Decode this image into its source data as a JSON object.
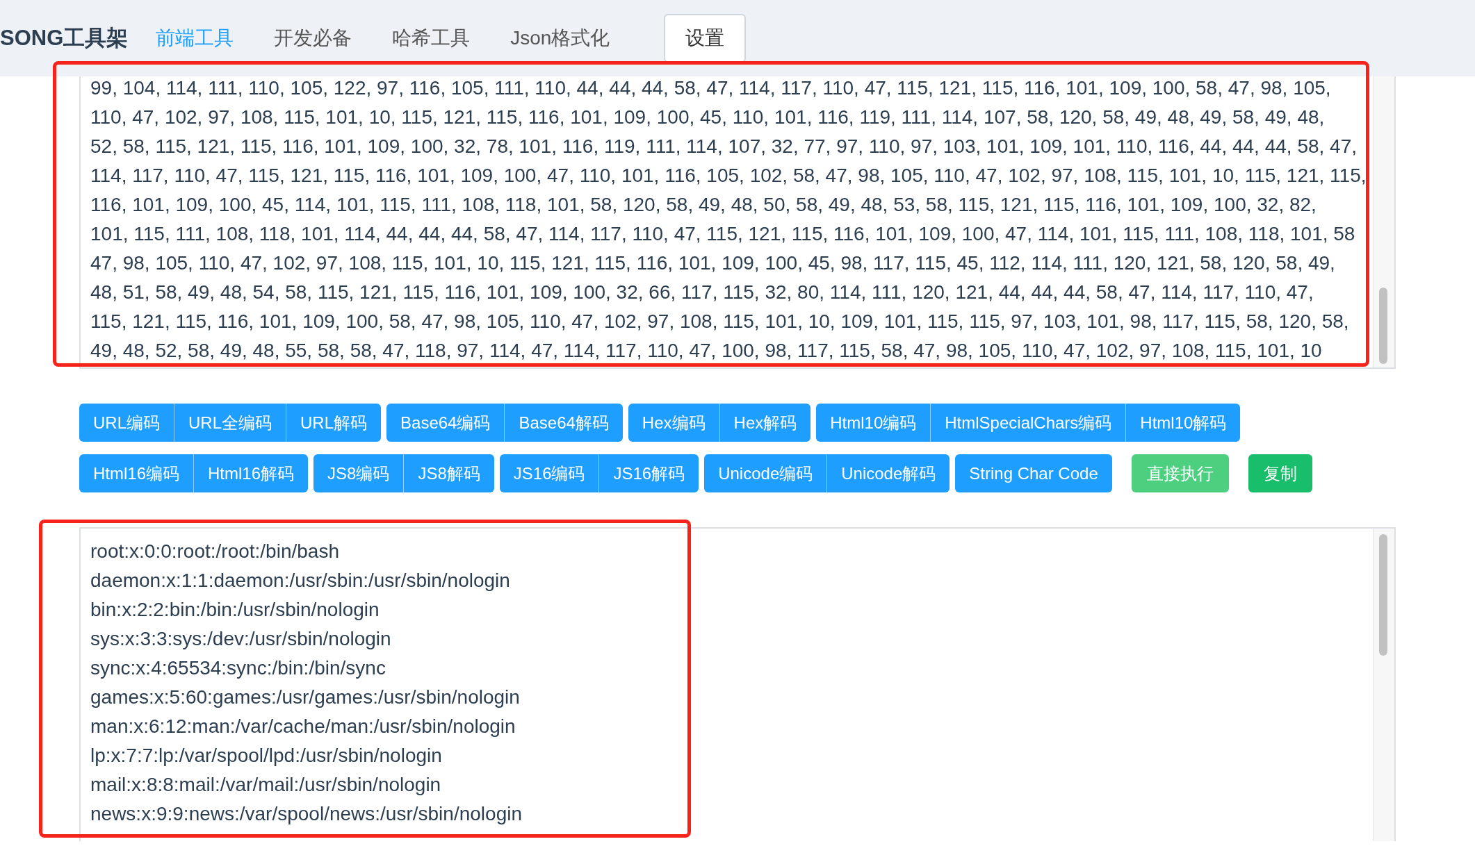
{
  "header": {
    "logo": "SONG工具架",
    "nav": [
      {
        "label": "前端工具",
        "selected": true
      },
      {
        "label": "开发必备",
        "selected": false
      },
      {
        "label": "哈希工具",
        "selected": false
      },
      {
        "label": "Json格式化",
        "selected": false
      }
    ],
    "settings_button": "设置"
  },
  "input_lines": [
    "99, 104, 114, 111, 110, 105, 122, 97, 116, 105, 111, 110, 44, 44, 44, 58, 47, 114, 117, 110, 47, 115, 121, 115, 116, 101, 109, 100, 58, 47, 98, 105,",
    "110, 47, 102, 97, 108, 115, 101, 10, 115, 121, 115, 116, 101, 109, 100, 45, 110, 101, 116, 119, 111, 114, 107, 58, 120, 58, 49, 48, 49, 58, 49, 48,",
    "52, 58, 115, 121, 115, 116, 101, 109, 100, 32, 78, 101, 116, 119, 111, 114, 107, 32, 77, 97, 110, 97, 103, 101, 109, 101, 110, 116, 44, 44, 44, 58, 47,",
    "114, 117, 110, 47, 115, 121, 115, 116, 101, 109, 100, 47, 110, 101, 116, 105, 102, 58, 47, 98, 105, 110, 47, 102, 97, 108, 115, 101, 10, 115, 121, 115,",
    "116, 101, 109, 100, 45, 114, 101, 115, 111, 108, 118, 101, 58, 120, 58, 49, 48, 50, 58, 49, 48, 53, 58, 115, 121, 115, 116, 101, 109, 100, 32, 82,",
    "101, 115, 111, 108, 118, 101, 114, 44, 44, 44, 58, 47, 114, 117, 110, 47, 115, 121, 115, 116, 101, 109, 100, 47, 114, 101, 115, 111, 108, 118, 101, 58",
    "47, 98, 105, 110, 47, 102, 97, 108, 115, 101, 10, 115, 121, 115, 116, 101, 109, 100, 45, 98, 117, 115, 45, 112, 114, 111, 120, 121, 58, 120, 58, 49,",
    "48, 51, 58, 49, 48, 54, 58, 115, 121, 115, 116, 101, 109, 100, 32, 66, 117, 115, 32, 80, 114, 111, 120, 121, 44, 44, 44, 58, 47, 114, 117, 110, 47,",
    "115, 121, 115, 116, 101, 109, 100, 58, 47, 98, 105, 110, 47, 102, 97, 108, 115, 101, 10, 109, 101, 115, 115, 97, 103, 101, 98, 117, 115, 58, 120, 58,",
    "49, 48, 52, 58, 49, 48, 55, 58, 58, 47, 118, 97, 114, 47, 114, 117, 110, 47, 100, 98, 117, 115, 58, 47, 98, 105, 110, 47, 102, 97, 108, 115, 101, 10"
  ],
  "button_groups": [
    [
      {
        "label": "URL编码",
        "kind": "primary"
      },
      {
        "label": "URL全编码",
        "kind": "primary"
      },
      {
        "label": "URL解码",
        "kind": "primary"
      }
    ],
    [
      {
        "label": "Base64编码",
        "kind": "primary"
      },
      {
        "label": "Base64解码",
        "kind": "primary"
      }
    ],
    [
      {
        "label": "Hex编码",
        "kind": "primary"
      },
      {
        "label": "Hex解码",
        "kind": "primary"
      }
    ],
    [
      {
        "label": "Html10编码",
        "kind": "primary"
      },
      {
        "label": "HtmlSpecialChars编码",
        "kind": "primary"
      },
      {
        "label": "Html10解码",
        "kind": "primary"
      }
    ],
    [
      {
        "label": "Html16编码",
        "kind": "primary"
      },
      {
        "label": "Html16解码",
        "kind": "primary"
      }
    ],
    [
      {
        "label": "JS8编码",
        "kind": "primary"
      },
      {
        "label": "JS8解码",
        "kind": "primary"
      }
    ],
    [
      {
        "label": "JS16编码",
        "kind": "primary"
      },
      {
        "label": "JS16解码",
        "kind": "primary"
      }
    ],
    [
      {
        "label": "Unicode编码",
        "kind": "primary"
      },
      {
        "label": "Unicode解码",
        "kind": "primary"
      }
    ],
    [
      {
        "label": "String Char Code",
        "kind": "primary"
      }
    ],
    [
      {
        "label": "直接执行",
        "kind": "light"
      }
    ],
    [
      {
        "label": "复制",
        "kind": "success"
      }
    ]
  ],
  "output_lines": [
    "root:x:0:0:root:/root:/bin/bash",
    "daemon:x:1:1:daemon:/usr/sbin:/usr/sbin/nologin",
    "bin:x:2:2:bin:/bin:/usr/sbin/nologin",
    "sys:x:3:3:sys:/dev:/usr/sbin/nologin",
    "sync:x:4:65534:sync:/bin:/bin/sync",
    "games:x:5:60:games:/usr/games:/usr/sbin/nologin",
    "man:x:6:12:man:/var/cache/man:/usr/sbin/nologin",
    "lp:x:7:7:lp:/var/spool/lpd:/usr/sbin/nologin",
    "mail:x:8:8:mail:/var/mail:/usr/sbin/nologin",
    "news:x:9:9:news:/var/spool/news:/usr/sbin/nologin"
  ]
}
